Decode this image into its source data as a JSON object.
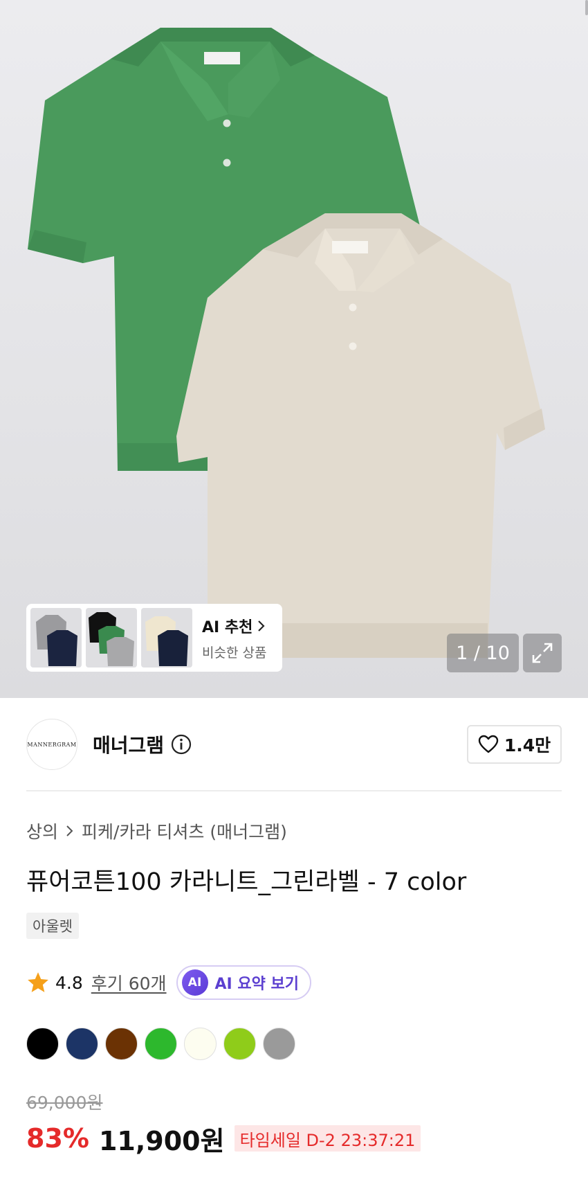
{
  "gallery": {
    "counter": "1 / 10",
    "ai_recommend": {
      "title": "AI 추천",
      "subtitle": "비슷한 상품"
    }
  },
  "brand": {
    "logo_text": "MANNERGRAM",
    "name": "매너그램",
    "likes": "1.4만"
  },
  "product": {
    "breadcrumb": [
      "상의",
      "피케/카라 티셔츠 (매너그램)"
    ],
    "title": "퓨어코튼100 카라니트_그린라벨 - 7 color",
    "tag": "아울렛",
    "rating": "4.8",
    "reviews": "후기 60개",
    "ai_badge": "AI",
    "ai_summary": "AI 요약 보기",
    "colors": [
      "#000000",
      "#1c3466",
      "#6b3204",
      "#2db82d",
      "#fdfdf0",
      "#8fcc1a",
      "#9a9a9a"
    ],
    "original_price": "69,000원",
    "discount": "83%",
    "sale_price": "11,900원",
    "timesale": "타임세일 D-2 23:37:21"
  },
  "theme": {
    "accent_red": "#e52a2a",
    "ai_purple": "#5b3fd0",
    "star": "#f5a01a"
  }
}
